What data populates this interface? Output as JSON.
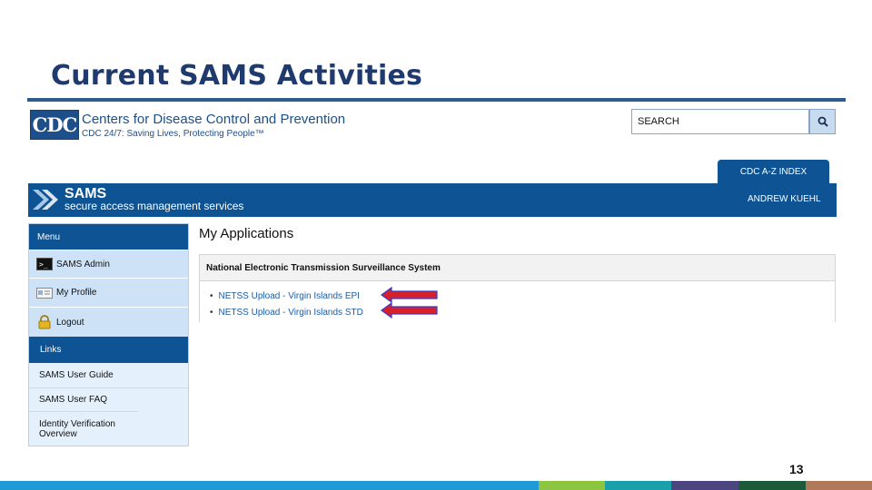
{
  "slide": {
    "title": "Current SAMS Activities",
    "page_number": "13"
  },
  "cdc_header": {
    "logo_text": "CDC",
    "org_name": "Centers for Disease Control and Prevention",
    "tagline": "CDC 24/7: Saving Lives, Protecting People™",
    "search_value": "SEARCH",
    "search_icon": "magnifier-icon",
    "az_tab_label": "CDC A-Z INDEX"
  },
  "sams_banner": {
    "title": "SAMS",
    "subtitle": "secure access management services",
    "user": "ANDREW KUEHL"
  },
  "sidebar": {
    "menu_header": "Menu",
    "menu_items": [
      {
        "label": "SAMS Admin",
        "icon": "terminal-icon"
      },
      {
        "label": "My Profile",
        "icon": "id-card-icon"
      },
      {
        "label": "Logout",
        "icon": "padlock-icon"
      }
    ],
    "links_header": "Links",
    "links": [
      {
        "label": "SAMS User Guide"
      },
      {
        "label": "SAMS User FAQ"
      },
      {
        "label": "Identity Verification Overview"
      }
    ]
  },
  "main": {
    "heading": "My Applications",
    "panel_title": "National Electronic Transmission Surveillance System",
    "applications": [
      {
        "label": "NETSS Upload - Virgin Islands EPI"
      },
      {
        "label": "NETSS Upload - Virgin Islands STD"
      }
    ]
  },
  "colors": {
    "title": "#1f3a6e",
    "banner": "#0e5393",
    "annotation_arrow": "#d6202a",
    "footer": [
      "#1f9ad6",
      "#8cc640",
      "#1aa0a8",
      "#4b4680",
      "#1d5a3a",
      "#b07a5a"
    ]
  }
}
